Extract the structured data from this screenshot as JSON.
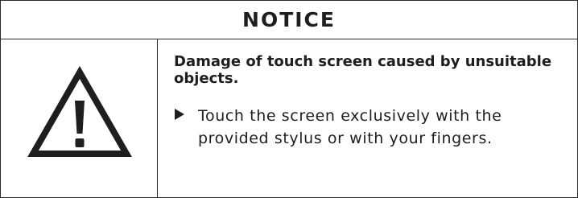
{
  "notice": {
    "title": "NOTICE",
    "icon": "warning-triangle-exclamation-icon",
    "hazard": "Damage of touch screen caused by unsuitable objects.",
    "instruction_icon": "triangle-right-bullet-icon",
    "instruction": "Touch the screen exclusively with the provided stylus or with your fingers."
  },
  "colors": {
    "border": "#2a2a2a",
    "text": "#1e1e1e",
    "background": "#ffffff"
  }
}
